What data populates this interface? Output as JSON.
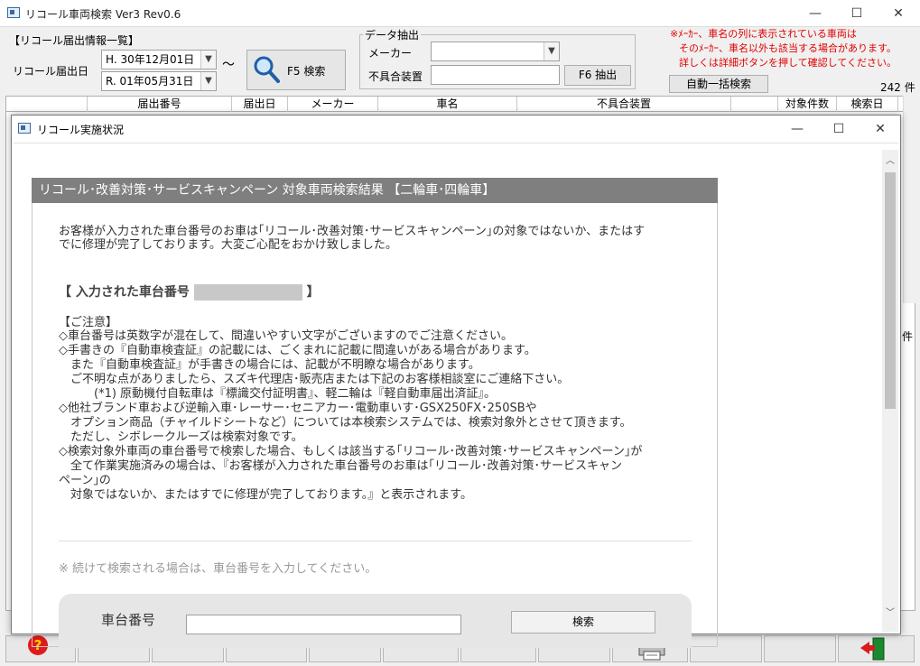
{
  "window": {
    "title": "リコール車両検索 Ver3 Rev0.6",
    "minimize": "—",
    "maximize": "☐",
    "close": "✕"
  },
  "recall_list": {
    "section_label": "【リコール届出情報一覧】",
    "date_label": "リコール届出日",
    "date_from": "H. 30年12月01日",
    "date_to": "R. 01年05月31日",
    "range_sep": "～",
    "search_button": "F5 検索"
  },
  "extract": {
    "group_label": "データ抽出",
    "maker_label": "メーカー",
    "maker_value": "",
    "defect_label": "不具合装置",
    "defect_value": "",
    "extract_button": "F6 抽出"
  },
  "notice": {
    "line1": "※ﾒｰｶｰ、車名の列に表示されている車両は",
    "line2": "そのﾒｰｶｰ、車名以外も該当する場合があります。",
    "line3": "詳しくは詳細ボタンを押して確認してください。"
  },
  "auto_search_button": "自動一括検索",
  "count": "242 件",
  "count_right": "件",
  "grid": {
    "columns": [
      "届出番号",
      "届出日",
      "メーカー",
      "車名",
      "不具合装置",
      "対象件数",
      "検索日"
    ]
  },
  "dialog": {
    "title": "リコール実施状況",
    "minimize": "—",
    "maximize": "☐",
    "close": "✕",
    "banner": "リコール･改善対策･サービスキャンペーン 対象車両検索結果 【二輪車･四輪車】",
    "intro_1": "お客様が入力された車台番号のお車は｢リコール･改善対策･サービスキャンペーン｣の対象ではないか、またはす",
    "intro_2": "でに修理が完了しております。大変ご心配をおかけ致しました。",
    "input_heading_open": "【 入力された車台番号",
    "input_heading_close": "】",
    "caution_title": "【ご注意】",
    "caution": [
      "◇車台番号は英数字が混在して、間違いやすい文字がございますのでご注意ください。",
      "◇手書きの『自動車検査証』の記載には、ごくまれに記載に間違いがある場合があります。",
      "　また『自動車検査証』が手書きの場合には、記載が不明瞭な場合があります。",
      "　ご不明な点がありましたら、スズキ代理店･販売店または下記のお客様相談室にご連絡下さい。",
      "　　　(*1) 原動機付自転車は『標識交付証明書』、軽二輪は『軽自動車届出済証』。",
      "◇他社ブランド車および逆輸入車･レーサー･セニアカー･電動車いす･GSX250FX･250SBや",
      "　オプション商品（チャイルドシートなど）については本検索システムでは、検索対象外とさせて頂きます。",
      "　ただし、シボレークルーズは検索対象です。",
      "◇検索対象外車両の車台番号で検索した場合、もしくは該当する｢リコール･改善対策･サービスキャンペーン｣が",
      "　全て作業実施済みの場合は、『お客様が入力された車台番号のお車は｢リコール･改善対策･サービスキャン",
      "ペーン｣の",
      "　対象ではないか、またはすでに修理が完了しております。』と表示されます。"
    ],
    "continue_note": "※ 続けて検索される場合は、車台番号を入力してください。",
    "chassis_label": "車台番号",
    "chassis_value": "",
    "search_button": "検索"
  }
}
